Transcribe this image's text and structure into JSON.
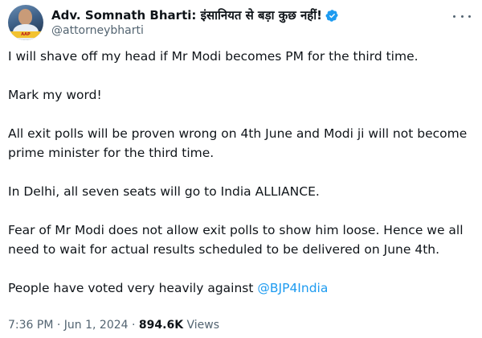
{
  "tweet": {
    "author": {
      "display_name": "Adv. Somnath Bharti: इंसानियत से बड़ा कुछ नहीं!",
      "handle": "@attorneybharti",
      "avatar_banner": "AAP",
      "verified": true
    },
    "paragraphs": [
      "I will shave off my head if Mr Modi becomes PM for the third time.",
      "Mark my word!",
      "All exit polls will be proven wrong on 4th June and Modi ji will not become prime minister for the third time.",
      "In Delhi, all seven seats will go to India ALLIANCE.",
      "Fear of Mr Modi does not allow exit polls to show him loose. Hence we all need to wait for actual results scheduled to be delivered on June 4th."
    ],
    "last_line": {
      "text": "People have voted very heavily against ",
      "mention": "@BJP4India"
    },
    "time": "7:36 PM",
    "date": "Jun 1, 2024",
    "views_count": "894.6K",
    "views_label": "Views",
    "separator": "·"
  },
  "icons": {
    "verified": "verified-badge-icon",
    "more": "more-options-icon"
  },
  "colors": {
    "text": "#0f1419",
    "secondary": "#536471",
    "link": "#1d9bf0"
  }
}
